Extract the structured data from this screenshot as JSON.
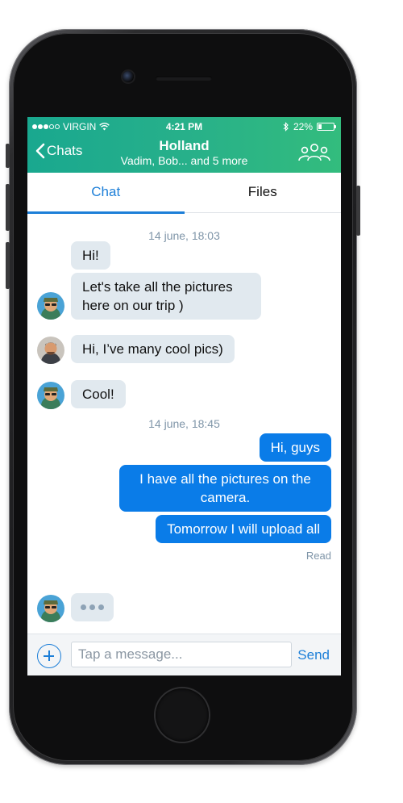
{
  "status_bar": {
    "carrier": "VIRGIN",
    "time": "4:21 PM",
    "battery": "22%",
    "battery_level": 0.22
  },
  "header": {
    "back_label": "Chats",
    "title": "Holland",
    "subtitle": "Vadim, Bob... and 5 more"
  },
  "tabs": [
    {
      "label": "Chat",
      "active": true
    },
    {
      "label": "Files",
      "active": false
    }
  ],
  "messages": {
    "sep1": "14 june, 18:03",
    "m1": "Hi!",
    "m2": "Let's take all the pictures here on our trip )",
    "m3": "Hi, I’ve many cool pics)",
    "m4": "Cool!",
    "sep2": "14 june, 18:45",
    "m5": "Hi, guys",
    "m6": "I have all the pictures on the camera.",
    "m7": "Tomorrow I will upload all",
    "read_status": "Read"
  },
  "composer": {
    "placeholder": "Tap a message...",
    "value": "",
    "send_label": "Send"
  },
  "colors": {
    "header_start": "#19a88f",
    "header_end": "#33bc7d",
    "accent": "#1d7fd8",
    "outgoing_bubble": "#0a7ce8",
    "incoming_bubble": "#e1e9ef"
  }
}
